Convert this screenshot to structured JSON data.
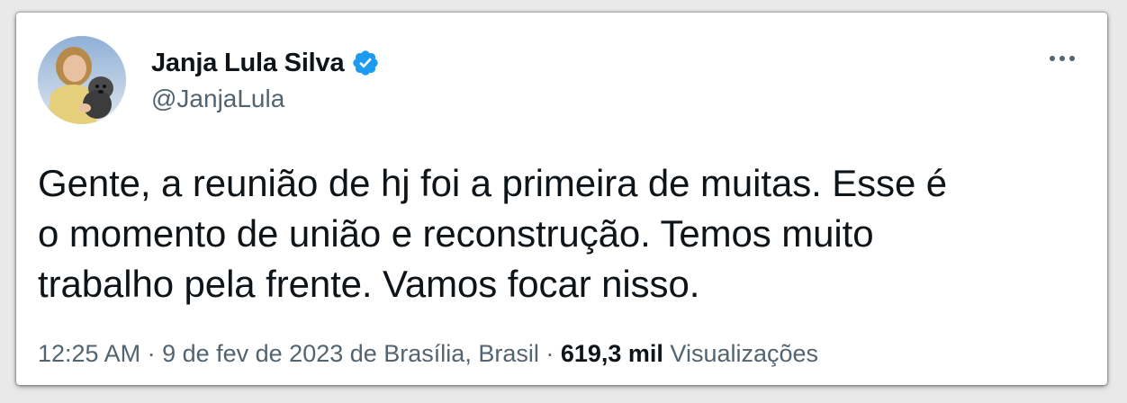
{
  "author": {
    "display_name": "Janja Lula Silva",
    "handle": "@JanjaLula",
    "verified": true
  },
  "tweet": {
    "lines": [
      "Gente, a reunião de hj foi a primeira de muitas. Esse é",
      "o momento de união e reconstrução. Temos muito",
      "trabalho pela frente. Vamos focar nisso."
    ]
  },
  "meta": {
    "time": "12:25 AM",
    "separator1": " · ",
    "date_location": "9 de fev de 2023 de Brasília, Brasil",
    "separator2": " · ",
    "views_count": "619,3 mil",
    "views_label": " Visualizações"
  },
  "colors": {
    "text_primary": "#0f1419",
    "text_secondary": "#536471",
    "verified_blue": "#1d9bf0"
  },
  "icons": {
    "verified": "verified-badge-icon",
    "more": "more-horizontal-icon"
  }
}
